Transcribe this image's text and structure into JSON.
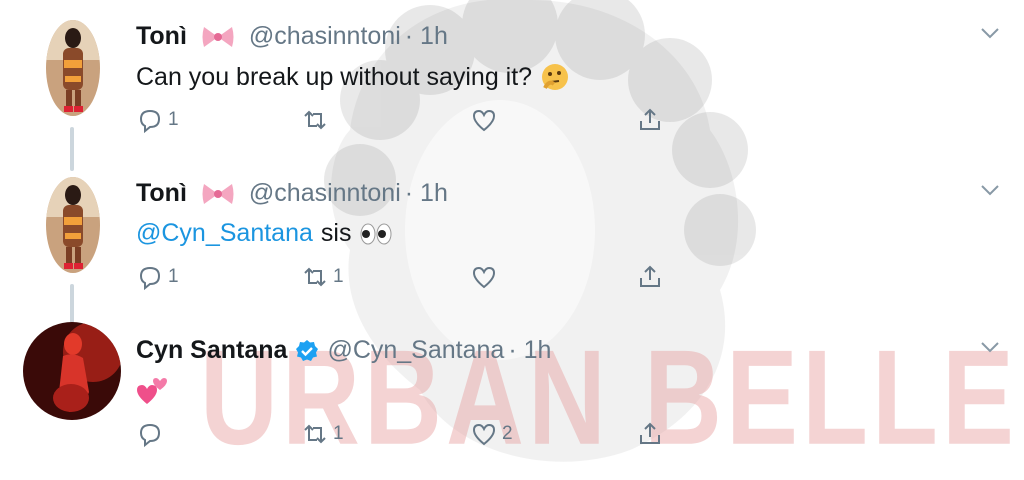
{
  "watermark": {
    "text": "URBAN BELLE"
  },
  "tweets": [
    {
      "name": "Tonì",
      "name_emoji": "bow-emoji",
      "handle": "@chasinntoni",
      "time": "· 1h",
      "text": "Can you break up without saying it?",
      "text_emoji": "thinking-face-emoji",
      "reply_count": "1",
      "retweet_count": "",
      "like_count": ""
    },
    {
      "name": "Tonì",
      "name_emoji": "bow-emoji",
      "handle": "@chasinntoni",
      "time": "· 1h",
      "mention": "@Cyn_Santana",
      "text": "sis",
      "text_emoji": "eyes-emoji",
      "reply_count": "1",
      "retweet_count": "1",
      "like_count": ""
    },
    {
      "name": "Cyn Santana",
      "verified": true,
      "handle": "@Cyn_Santana",
      "time": "· 1h",
      "text_emoji": "two-hearts-emoji",
      "reply_count": "",
      "retweet_count": "1",
      "like_count": "2"
    }
  ],
  "colors": {
    "mention": "#1b95e0",
    "secondary": "#657786",
    "verified": "#1da1f2",
    "thread_line": "#ccd6dd"
  }
}
